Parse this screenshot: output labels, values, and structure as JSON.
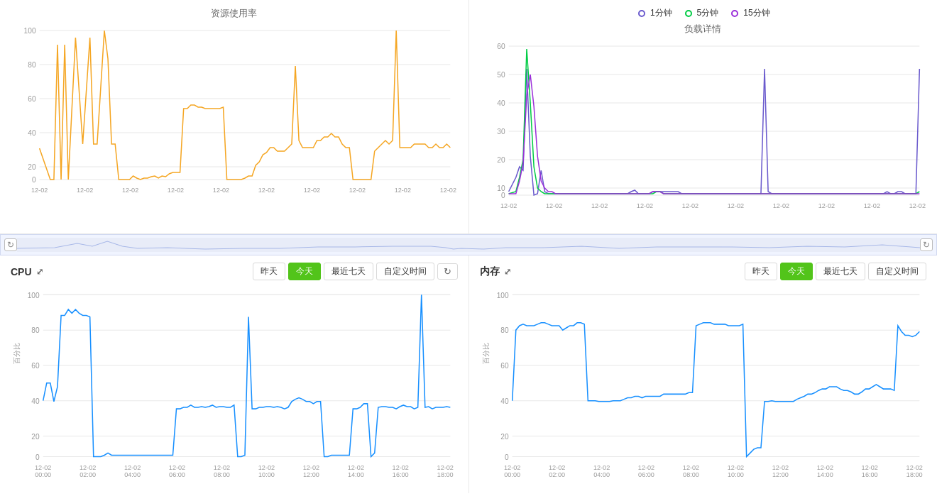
{
  "top": {
    "left": {
      "title": "资源使用率",
      "yMax": 100,
      "color": "#f5a623"
    },
    "right": {
      "title": "负载详情",
      "yMax": 60,
      "legend": [
        {
          "label": "1分钟",
          "color": "#6a5acd",
          "dotColor": "#6a5acd"
        },
        {
          "label": "5分钟",
          "color": "#00cc44",
          "dotColor": "#00cc44"
        },
        {
          "label": "15分钟",
          "color": "#9b30d9",
          "dotColor": "#9b30d9"
        }
      ]
    }
  },
  "bottom": {
    "left": {
      "title": "CPU",
      "yAxisLabel": "百分比",
      "yMax": 100,
      "color": "#1890ff",
      "buttons": [
        "昨天",
        "今天",
        "最近七天",
        "自定义时间"
      ],
      "activeButton": "今天"
    },
    "right": {
      "title": "内存",
      "yAxisLabel": "百分比",
      "yMax": 100,
      "color": "#1890ff",
      "buttons": [
        "昨天",
        "今天",
        "最近七天",
        "自定义时间"
      ],
      "activeButton": "今天"
    }
  },
  "xLabels": [
    "12-02\n00:00",
    "12-02\n02:00",
    "12-02\n04:00",
    "12-02\n06:00",
    "12-02\n08:00",
    "12-02\n10:00",
    "12-02\n12:00",
    "12-02\n14:00",
    "12-02\n16:00",
    "12-02\n18:00"
  ]
}
